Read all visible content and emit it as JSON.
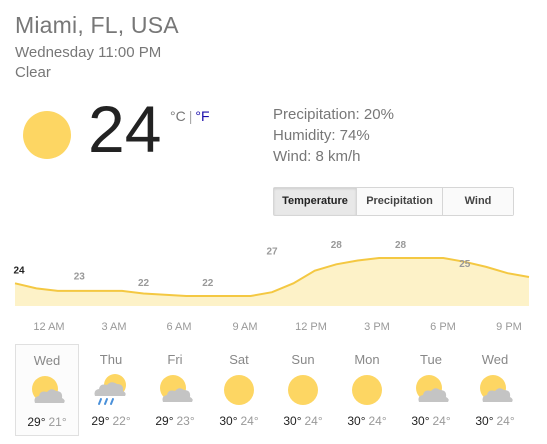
{
  "location": "Miami, FL, USA",
  "datetime": "Wednesday 11:00 PM",
  "condition": "Clear",
  "current": {
    "temp": "24",
    "unit_c": "°C",
    "unit_sep": "|",
    "unit_f": "°F",
    "icon": "sun-icon"
  },
  "details": {
    "precipitation": "Precipitation: 20%",
    "humidity": "Humidity: 74%",
    "wind": "Wind: 8 km/h"
  },
  "tabs": [
    {
      "label": "Temperature",
      "active": true
    },
    {
      "label": "Precipitation",
      "active": false
    },
    {
      "label": "Wind",
      "active": false
    }
  ],
  "colors": {
    "sun": "#fdd663",
    "area_fill": "#fdf2c8",
    "area_line": "#f4c842",
    "cloud": "#c4c4c4",
    "rain": "#4a90d9"
  },
  "chart_data": {
    "type": "area",
    "x_labels": [
      "12 AM",
      "3 AM",
      "6 AM",
      "9 AM",
      "12 PM",
      "3 PM",
      "6 PM",
      "9 PM"
    ],
    "hours": [
      23,
      0,
      1,
      2,
      3,
      4,
      5,
      6,
      7,
      8,
      9,
      10,
      11,
      12,
      13,
      14,
      15,
      16,
      17,
      18,
      19,
      20,
      21,
      22,
      23
    ],
    "values": [
      24,
      23.2,
      22.8,
      22.8,
      22.8,
      22.8,
      22.4,
      22.2,
      22,
      22,
      22,
      22,
      22.6,
      24,
      26,
      27,
      27.6,
      28,
      28,
      28,
      28,
      27.4,
      26.6,
      25.6,
      25
    ],
    "labels": [
      {
        "hour": 23,
        "value": 24,
        "text": "24",
        "first": true
      },
      {
        "hour": 2,
        "value": 23,
        "text": "23"
      },
      {
        "hour": 5,
        "value": 22,
        "text": "22"
      },
      {
        "hour": 8,
        "value": 22,
        "text": "22"
      },
      {
        "hour": 11,
        "value": 27,
        "text": "27"
      },
      {
        "hour": 14,
        "value": 28,
        "text": "28"
      },
      {
        "hour": 17,
        "value": 28,
        "text": "28"
      },
      {
        "hour": 20,
        "value": 25,
        "text": "25"
      }
    ]
  },
  "forecast": [
    {
      "day": "Wed",
      "hi": "29°",
      "lo": "21°",
      "icon": "partly-cloudy-icon",
      "selected": true
    },
    {
      "day": "Thu",
      "hi": "29°",
      "lo": "22°",
      "icon": "rain-icon",
      "selected": false
    },
    {
      "day": "Fri",
      "hi": "29°",
      "lo": "23°",
      "icon": "partly-cloudy-icon",
      "selected": false
    },
    {
      "day": "Sat",
      "hi": "30°",
      "lo": "24°",
      "icon": "sun-icon",
      "selected": false
    },
    {
      "day": "Sun",
      "hi": "30°",
      "lo": "24°",
      "icon": "sun-icon",
      "selected": false
    },
    {
      "day": "Mon",
      "hi": "30°",
      "lo": "24°",
      "icon": "sun-icon",
      "selected": false
    },
    {
      "day": "Tue",
      "hi": "30°",
      "lo": "24°",
      "icon": "partly-cloudy-icon",
      "selected": false
    },
    {
      "day": "Wed",
      "hi": "30°",
      "lo": "24°",
      "icon": "partly-cloudy-icon",
      "selected": false
    }
  ]
}
